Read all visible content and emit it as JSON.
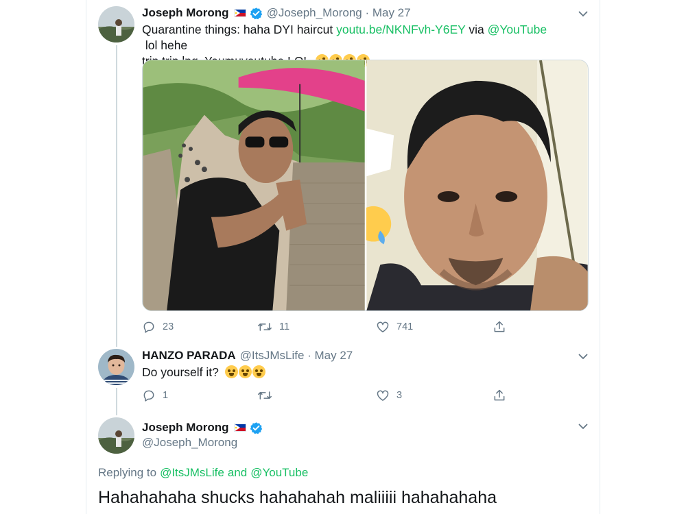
{
  "tweets": [
    {
      "display_name": "Joseph Morong",
      "handle": "@Joseph_Morong",
      "date": "May 27",
      "text_before_link": "Quarantine things: haha DYI haircut ",
      "link": "youtu.be/NKNFvh-Y6EY",
      "text_via": " via ",
      "mention": "@YouTube",
      "text_after": " lol hehe",
      "line2": "trip trip lng. Youmuyoutube LOL",
      "emoji_count": 4,
      "emoji_name": "rolling-on-floor-laughing",
      "replies": "23",
      "retweets": "11",
      "likes": "741"
    },
    {
      "display_name": "HANZO PARADA",
      "handle": "@ItsJMsLife",
      "date": "May 27",
      "text": "Do yourself it?",
      "emoji_count": 3,
      "emoji_name": "zany-face",
      "replies": "1",
      "retweets": "",
      "likes": "3"
    },
    {
      "display_name": "Joseph Morong",
      "handle": "@Joseph_Morong",
      "replying_to_label": "Replying to",
      "reply_mention_1": "@ItsJMsLife",
      "reply_and": "and",
      "reply_mention_2": "@YouTube",
      "text": "Hahahahaha shucks hahahahah maliiiii hahahahaha"
    }
  ],
  "separator": " · ",
  "colors": {
    "link": "#17bf63",
    "muted": "#657786",
    "verified": "#1da1f2",
    "umbrella": "#e3418a"
  },
  "icons": [
    "reply-icon",
    "retweet-icon",
    "like-icon",
    "share-icon",
    "chevron-down-icon",
    "verified-badge-icon",
    "philippines-flag-icon"
  ]
}
